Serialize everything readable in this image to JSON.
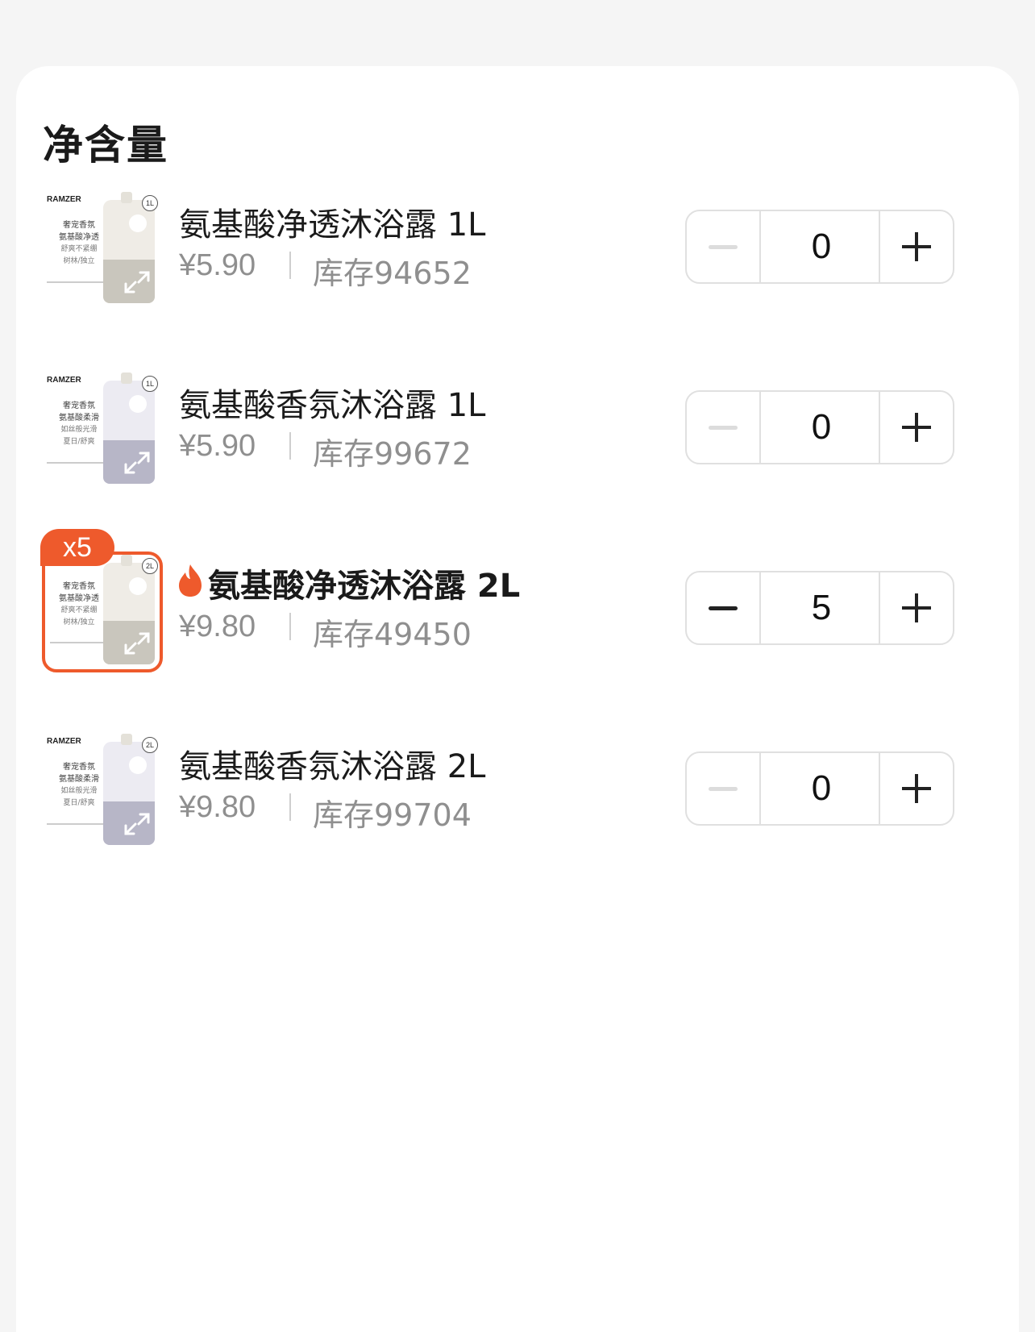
{
  "section": {
    "title": "净含量"
  },
  "items": [
    {
      "brand": "RAMZER",
      "thumb_lines": [
        "奢宠香氛",
        "氨基酸净透",
        "舒爽不紧绷",
        "树林/独立"
      ],
      "size_badge": "1L",
      "bottle_color": "#efece6",
      "band_color": "#c9c6bd",
      "name": "氨基酸净透沐浴露 1L",
      "price": "¥5.90",
      "stock": "库存94652",
      "quantity": "0",
      "selected": false,
      "qty_tag": ""
    },
    {
      "brand": "RAMZER",
      "thumb_lines": [
        "奢宠香氛",
        "氨基酸柔滑",
        "如丝般光滑",
        "夏日/舒爽"
      ],
      "size_badge": "1L",
      "bottle_color": "#ecebf2",
      "band_color": "#b7b6c7",
      "name": "氨基酸香氛沐浴露 1L",
      "price": "¥5.90",
      "stock": "库存99672",
      "quantity": "0",
      "selected": false,
      "qty_tag": ""
    },
    {
      "brand": "",
      "thumb_lines": [
        "奢宠香氛",
        "氨基酸净透",
        "舒爽不紧绷",
        "树林/独立"
      ],
      "size_badge": "2L",
      "bottle_color": "#efece6",
      "band_color": "#c9c6bd",
      "name": "氨基酸净透沐浴露 2L",
      "price": "¥9.80",
      "stock": "库存49450",
      "quantity": "5",
      "selected": true,
      "qty_tag": "x5"
    },
    {
      "brand": "RAMZER",
      "thumb_lines": [
        "奢宠香氛",
        "氨基酸柔滑",
        "如丝般光滑",
        "夏日/舒爽"
      ],
      "size_badge": "2L",
      "bottle_color": "#ecebf2",
      "band_color": "#b7b6c7",
      "name": "氨基酸香氛沐浴露 2L",
      "price": "¥9.80",
      "stock": "库存99704",
      "quantity": "0",
      "selected": false,
      "qty_tag": ""
    }
  ],
  "colors": {
    "accent": "#ee5a2c",
    "muted_text": "#8f8f8f"
  }
}
